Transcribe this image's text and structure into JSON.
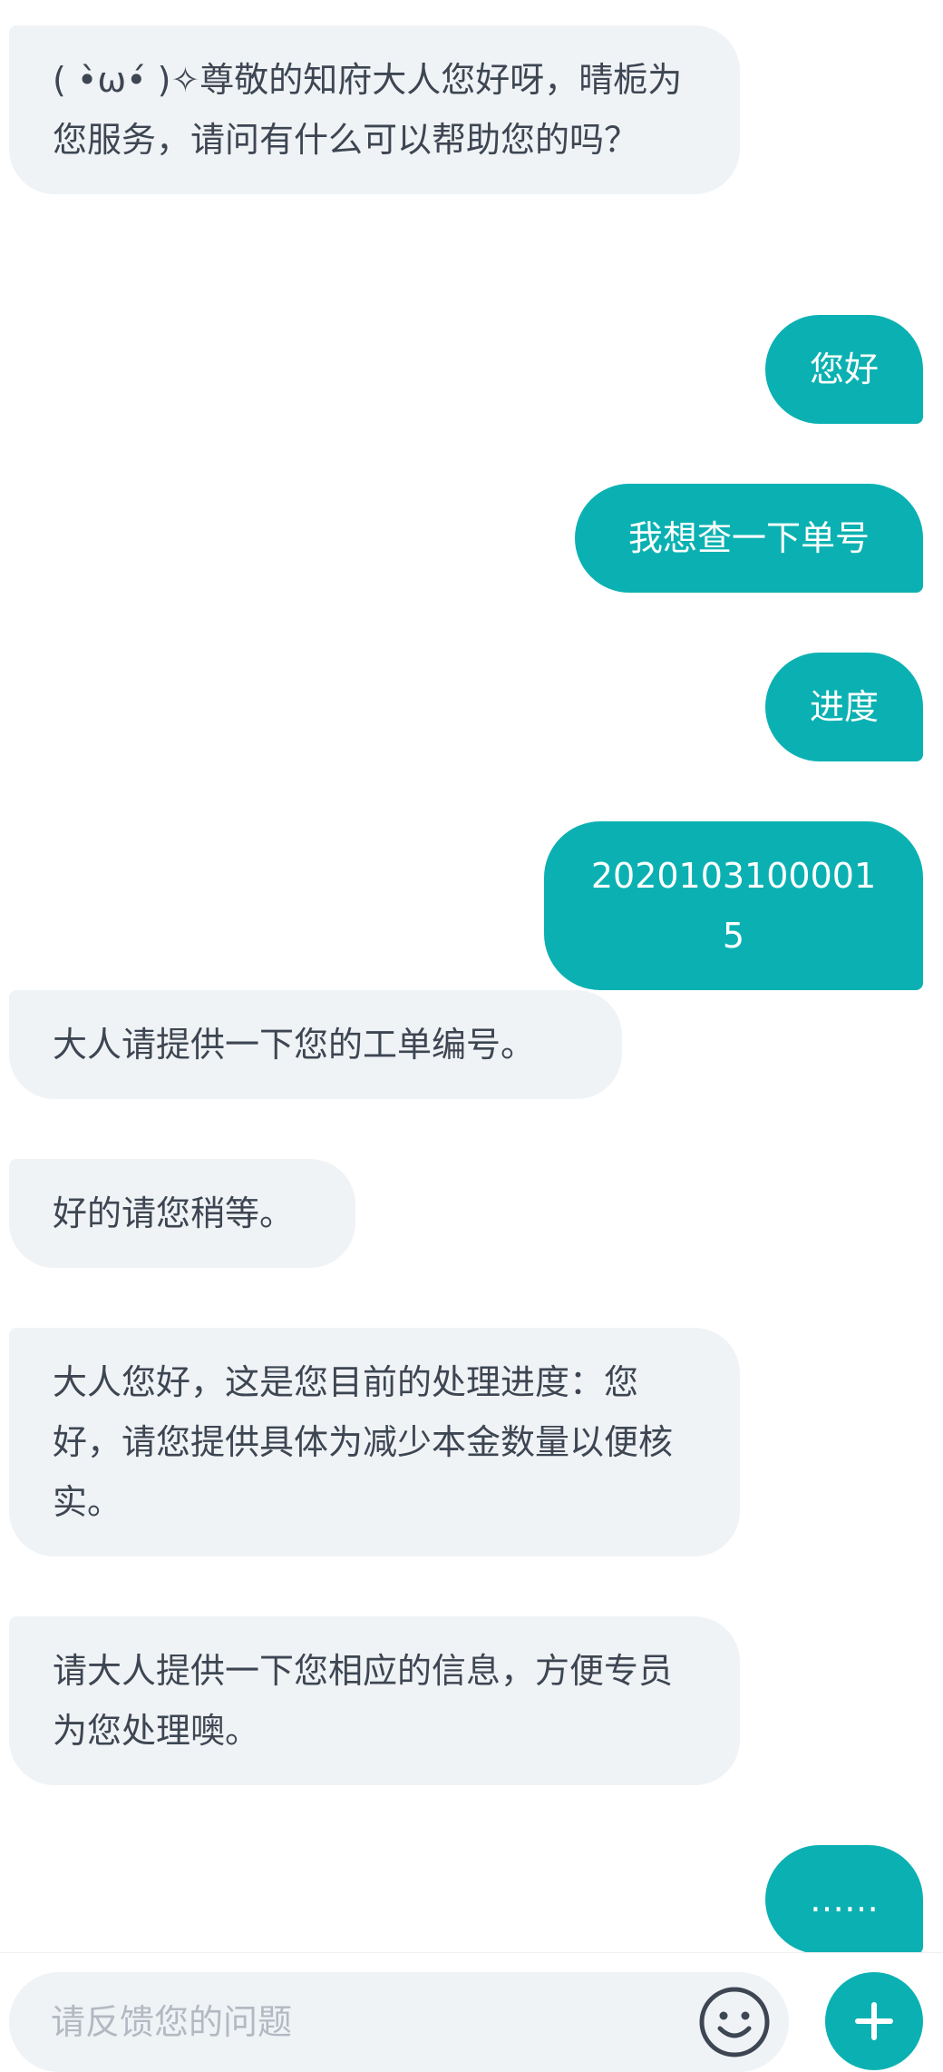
{
  "chat": {
    "messages": [
      {
        "role": "bot",
        "text": "( •̀ω•́ )✧尊敬的知府大人您好呀，晴栀为您服务，请问有什么可以帮助您的吗？"
      },
      {
        "role": "user",
        "text": "您好"
      },
      {
        "role": "user",
        "text": "我想查一下单号"
      },
      {
        "role": "user",
        "text": "进度"
      },
      {
        "role": "user",
        "text": "20201031000015"
      },
      {
        "role": "bot",
        "text": "大人请提供一下您的工单编号。"
      },
      {
        "role": "bot",
        "text": "好的请您稍等。"
      },
      {
        "role": "bot",
        "text": "大人您好，这是您目前的处理进度：您好，请您提供具体为减少本金数量以便核实。"
      },
      {
        "role": "bot",
        "text": "请大人提供一下您相应的信息，方便专员为您处理噢。"
      },
      {
        "role": "user",
        "text": "……"
      }
    ]
  },
  "input_bar": {
    "placeholder": "请反馈您的问题",
    "value": "",
    "emoji_icon": "smiley-face-icon",
    "plus_icon": "plus-icon"
  },
  "colors": {
    "accent": "#0bb1b2",
    "bot_bubble": "#f0f3f6",
    "bot_text": "#3d4652",
    "placeholder": "#b3b9c2"
  }
}
